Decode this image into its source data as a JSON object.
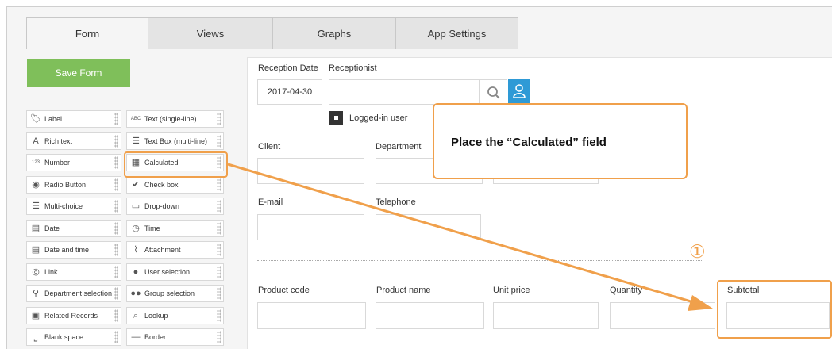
{
  "tabs": [
    "Form",
    "Views",
    "Graphs",
    "App Settings"
  ],
  "save_button": "Save Form",
  "palette": [
    {
      "label": "Label",
      "icon": "tag-icon",
      "glyph": "🏷"
    },
    {
      "label": "Text (single-line)",
      "icon": "text-single-icon",
      "glyph": "ABC"
    },
    {
      "label": "Rich text",
      "icon": "rich-text-icon",
      "glyph": "A"
    },
    {
      "label": "Text Box (multi-line)",
      "icon": "text-multi-icon",
      "glyph": "☰"
    },
    {
      "label": "Number",
      "icon": "number-icon",
      "glyph": "123"
    },
    {
      "label": "Calculated",
      "icon": "calculator-icon",
      "glyph": "▦"
    },
    {
      "label": "Radio Button",
      "icon": "radio-icon",
      "glyph": "◉"
    },
    {
      "label": "Check box",
      "icon": "checkbox-icon",
      "glyph": "✔"
    },
    {
      "label": "Multi-choice",
      "icon": "multi-choice-icon",
      "glyph": "☰"
    },
    {
      "label": "Drop-down",
      "icon": "dropdown-icon",
      "glyph": "▭"
    },
    {
      "label": "Date",
      "icon": "calendar-icon",
      "glyph": "▤"
    },
    {
      "label": "Time",
      "icon": "clock-icon",
      "glyph": "◷"
    },
    {
      "label": "Date and time",
      "icon": "datetime-icon",
      "glyph": "▤"
    },
    {
      "label": "Attachment",
      "icon": "paperclip-icon",
      "glyph": "⌇"
    },
    {
      "label": "Link",
      "icon": "link-icon",
      "glyph": "◎"
    },
    {
      "label": "User selection",
      "icon": "user-icon",
      "glyph": "●"
    },
    {
      "label": "Department selection",
      "icon": "org-icon",
      "glyph": "⚲"
    },
    {
      "label": "Group selection",
      "icon": "group-icon",
      "glyph": "●●"
    },
    {
      "label": "Related Records",
      "icon": "related-records-icon",
      "glyph": "▣"
    },
    {
      "label": "Lookup",
      "icon": "lookup-icon",
      "glyph": "⌕"
    },
    {
      "label": "Blank space",
      "icon": "blank-space-icon",
      "glyph": "⎵"
    },
    {
      "label": "Border",
      "icon": "border-icon",
      "glyph": "—"
    }
  ],
  "form": {
    "reception_date_label": "Reception Date",
    "reception_date_value": "2017-04-30",
    "receptionist_label": "Receptionist",
    "logged_in_user": "Logged-in user",
    "client_label": "Client",
    "department_label": "Department",
    "email_label": "E-mail",
    "telephone_label": "Telephone",
    "table_headers": [
      "Product code",
      "Product name",
      "Unit price",
      "Quantity",
      "Subtotal"
    ]
  },
  "callout": {
    "text": "Place the “Calculated” field",
    "step_marker": "①",
    "highlight_color": "#f0a04b"
  },
  "colors": {
    "save_button": "#7fbf5a",
    "user_picker": "#2e9ad6",
    "annotation": "#f0a04b"
  }
}
